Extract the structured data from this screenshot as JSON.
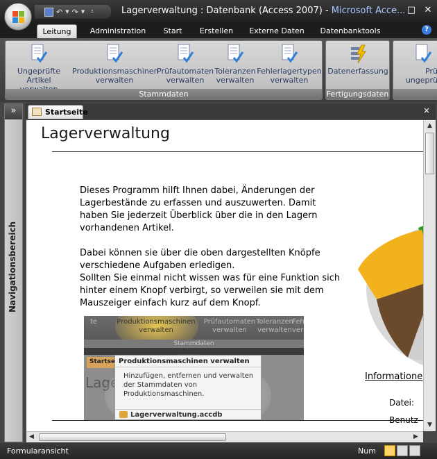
{
  "window": {
    "title": "Lagerverwaltung : Datenbank (Access 2007)",
    "separator": " - ",
    "app_name": "Microsoft Acce..."
  },
  "tabs": [
    {
      "label": "Leitung",
      "active": true
    },
    {
      "label": "Administration"
    },
    {
      "label": "Start"
    },
    {
      "label": "Erstellen"
    },
    {
      "label": "Externe Daten"
    },
    {
      "label": "Datenbanktools"
    }
  ],
  "ribbon": {
    "groups": [
      {
        "label": "Stammdaten"
      },
      {
        "label": "Fertigungsdaten"
      }
    ],
    "buttons": [
      {
        "label": "Ungeprüfte\nArtikel verwalten",
        "icon": "document-check-icon"
      },
      {
        "label": "Produktionsmaschinen\nverwalten",
        "icon": "document-check-icon"
      },
      {
        "label": "Prüfautomaten\nverwalten",
        "icon": "document-check-icon"
      },
      {
        "label": "Toleranzen\nverwalten",
        "icon": "document-check-icon"
      },
      {
        "label": "Fehlerlagertypen\nverwalten",
        "icon": "document-check-icon"
      },
      {
        "label": "Datenerfassung",
        "icon": "lightning-icon"
      },
      {
        "label": "Prü\nungeprü",
        "icon": "document-check-icon"
      }
    ]
  },
  "nav": {
    "label": "Navigationsbereich",
    "toggle": "»"
  },
  "document_tab": {
    "label": "Startseite",
    "close": "×"
  },
  "form": {
    "title": "Lagerverwaltung",
    "paragraph1": "Dieses Programm hilft Ihnen dabei, Änderungen der Lagerbestände zu erfassen und auszuwerten. Damit haben Sie jederzeit Überblick über die in den Lagern vorhandenen Artikel.",
    "paragraph2_line1": "Dabei können sie über die oben dargestellten Knöpfe verschiedene Aufgaben erledigen.",
    "paragraph2_line2": "Sollten Sie einmal nicht wissen was für eine Funktion sich hinter einem Knopf verbirgt, so verweilen sie mit dem Mauszeiger einfach kurz auf dem Knopf.",
    "info_heading": "Informatione",
    "info_labels": [
      "Datei:",
      "Benutz"
    ]
  },
  "screenshot": {
    "ribbon_items": [
      "te",
      "Produktionsmaschinen\nverwalten",
      "Prüfautomaten\nverwalten",
      "Toleranzen\nverwalten",
      "Fehlerl\nver"
    ],
    "group_label": "Stammdaten",
    "tab_label": "Startse",
    "tooltip_title": "Produktionsmaschinen verwalten",
    "tooltip_body": "Hinzufügen, entfernen und verwalten der Stammdaten von Produktionsmaschinen.",
    "tooltip_footer": "Lagerverwaltung.accdb",
    "bg_title": "Lager"
  },
  "status": {
    "left": "Formularansicht",
    "num": "Num"
  },
  "colors": {
    "accent_blue": "#a6c8ff",
    "ribbon_text": "#2a3a63",
    "pie_yellow": "#f2b21e",
    "pie_brown": "#6b4a2b",
    "pie_red": "#a31d1d",
    "pie_green": "#3a9c2a"
  }
}
